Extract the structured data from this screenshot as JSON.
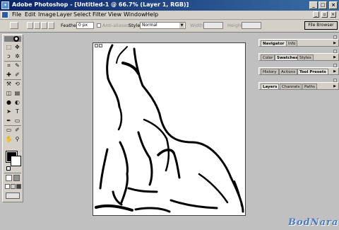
{
  "window": {
    "title": "Adobe Photoshop - [Untitled-1 @ 66.7% (Layer 1, RGB)]",
    "minimize": "_",
    "maximize": "□",
    "close": "×"
  },
  "menu": [
    "File",
    "Edit",
    "Image",
    "Layer",
    "Select",
    "Filter",
    "View",
    "Window",
    "Help"
  ],
  "options": {
    "feather_label": "Feather:",
    "feather_value": "0 px",
    "anti_aliased_label": "Anti-aliased",
    "style_label": "Style:",
    "style_value": "Normal",
    "width_label": "Width:",
    "height_label": "Height:",
    "file_browser": "File Browser"
  },
  "panels": [
    {
      "tabs": [
        "Navigator",
        "Info"
      ],
      "active": 0
    },
    {
      "tabs": [
        "Color",
        "Swatches",
        "Styles"
      ],
      "active": 1
    },
    {
      "tabs": [
        "History",
        "Actions",
        "Tool Presets"
      ],
      "active": 2
    },
    {
      "tabs": [
        "Layers",
        "Channels",
        "Paths"
      ],
      "active": 0
    }
  ],
  "tools": [
    "marquee-tool",
    "move-tool",
    "lasso-tool",
    "magic-wand-tool",
    "crop-tool",
    "slice-tool",
    "healing-brush-tool",
    "brush-tool",
    "clone-stamp-tool",
    "history-brush-tool",
    "eraser-tool",
    "gradient-tool",
    "blur-tool",
    "dodge-tool",
    "path-selection-tool",
    "type-tool",
    "pen-tool",
    "shape-tool",
    "notes-tool",
    "eyedropper-tool",
    "hand-tool",
    "zoom-tool"
  ],
  "tool_glyphs": [
    "⬚",
    "✥",
    "ↄ",
    "✲",
    "⌗",
    "✎",
    "✚",
    "✐",
    "⚒",
    "⟲",
    "◫",
    "▤",
    "●",
    "◐",
    "➤",
    "T",
    "✒",
    "▭",
    "▭",
    "✐",
    "✋",
    "⚲"
  ],
  "colors": {
    "title_start": "#0a246a",
    "title_end": "#3a6ea5",
    "chrome": "#d4d0c8",
    "workspace": "#c0c0c0",
    "foreground": "#000000",
    "background": "#ffffff"
  },
  "watermark": "BodNara"
}
